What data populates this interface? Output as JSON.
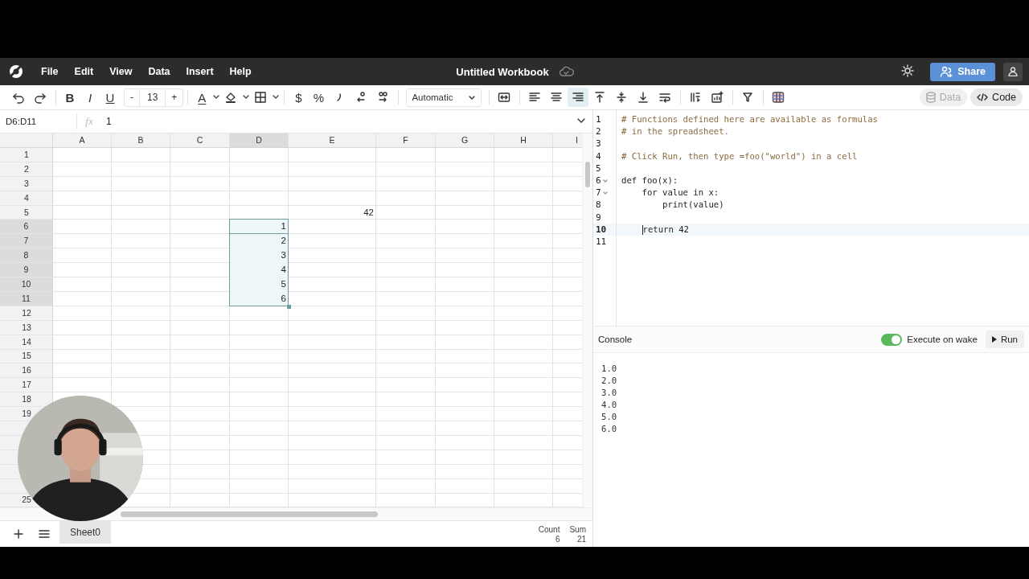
{
  "menubar": {
    "menus": [
      "File",
      "Edit",
      "View",
      "Data",
      "Insert",
      "Help"
    ],
    "title": "Untitled Workbook",
    "share_label": "Share"
  },
  "toolbar": {
    "format_buttons": [
      {
        "label": "B",
        "kind": "bold"
      },
      {
        "label": "I",
        "kind": "italic"
      },
      {
        "label": "U",
        "kind": "underline"
      }
    ],
    "decrease_label": "-",
    "font_size": "13",
    "increase_label": "+",
    "text_color_label": "A",
    "currency_label": "$",
    "percent_label": "%",
    "number_format": "Automatic",
    "align_buttons": [
      {
        "selected": false
      },
      {
        "selected": false
      },
      {
        "selected": true
      }
    ],
    "panel_tabs": [
      {
        "label": "Data",
        "selected": false
      },
      {
        "label": "Code",
        "selected": true
      }
    ]
  },
  "formula_bar": {
    "reference": "D6:D11",
    "fx_label": "fx",
    "value": "1"
  },
  "sheet": {
    "columns": [
      {
        "label": "A",
        "selected": false
      },
      {
        "label": "B",
        "selected": false
      },
      {
        "label": "C",
        "selected": false
      },
      {
        "label": "D",
        "selected": true
      },
      {
        "label": "E",
        "selected": false
      },
      {
        "label": "F",
        "selected": false
      },
      {
        "label": "G",
        "selected": false
      },
      {
        "label": "H",
        "selected": false
      },
      {
        "label": "I",
        "selected": false
      }
    ],
    "rows": [
      {
        "kind": "numbered",
        "label": "1",
        "selected": false
      },
      {
        "kind": "numbered",
        "label": "2",
        "selected": false
      },
      {
        "kind": "numbered",
        "label": "3",
        "selected": false
      },
      {
        "kind": "numbered",
        "label": "4",
        "selected": false
      },
      {
        "kind": "numbered",
        "label": "5",
        "selected": false,
        "cells": [
          null,
          null,
          null,
          null,
          "42",
          null,
          null,
          null,
          null
        ]
      },
      {
        "kind": "numbered",
        "label": "6",
        "selected": true,
        "cells": [
          null,
          null,
          null,
          "1",
          null,
          null,
          null,
          null,
          null
        ]
      },
      {
        "kind": "numbered",
        "label": "7",
        "selected": true,
        "cells": [
          null,
          null,
          null,
          "2",
          null,
          null,
          null,
          null,
          null
        ]
      },
      {
        "kind": "numbered",
        "label": "8",
        "selected": true,
        "cells": [
          null,
          null,
          null,
          "3",
          null,
          null,
          null,
          null,
          null
        ]
      },
      {
        "kind": "numbered",
        "label": "9",
        "selected": true,
        "cells": [
          null,
          null,
          null,
          "4",
          null,
          null,
          null,
          null,
          null
        ]
      },
      {
        "kind": "numbered",
        "label": "10",
        "selected": true,
        "cells": [
          null,
          null,
          null,
          "5",
          null,
          null,
          null,
          null,
          null
        ]
      },
      {
        "kind": "numbered",
        "label": "11",
        "selected": true,
        "cells": [
          null,
          null,
          null,
          "6",
          null,
          null,
          null,
          null,
          null
        ]
      },
      {
        "kind": "numbered",
        "label": "12",
        "selected": false
      },
      {
        "kind": "numbered",
        "label": "13",
        "selected": false
      },
      {
        "kind": "numbered",
        "label": "14",
        "selected": false
      },
      {
        "kind": "numbered",
        "label": "15",
        "selected": false
      },
      {
        "kind": "numbered",
        "label": "16",
        "selected": false
      },
      {
        "kind": "numbered",
        "label": "17",
        "selected": false
      },
      {
        "kind": "numbered",
        "label": "18",
        "selected": false
      },
      {
        "kind": "numbered",
        "label": "19",
        "selected": false
      },
      {
        "kind": "covered"
      },
      {
        "kind": "covered"
      },
      {
        "kind": "covered"
      },
      {
        "kind": "covered"
      },
      {
        "kind": "covered"
      },
      {
        "kind": "numbered",
        "label": "25",
        "selected": false
      }
    ]
  },
  "sheet_tabs": [
    {
      "label": "Sheet0",
      "selected": true
    }
  ],
  "summary": [
    {
      "label": "Count",
      "value": "6"
    },
    {
      "label": "Sum",
      "value": "21"
    }
  ],
  "editor": {
    "lines": [
      {
        "number": "1",
        "kind": "comment",
        "text": "# Functions defined here are available as formulas"
      },
      {
        "number": "2",
        "kind": "comment",
        "text": "# in the spreadsheet."
      },
      {
        "number": "3"
      },
      {
        "number": "4",
        "kind": "comment",
        "text": "# Click Run, then type =foo(\"world\") in a cell"
      },
      {
        "number": "5"
      },
      {
        "number": "6",
        "kind": "code",
        "text": "def foo(x):",
        "foldable": true
      },
      {
        "number": "7",
        "kind": "code",
        "text": "    for value in x:",
        "foldable": true
      },
      {
        "number": "8",
        "kind": "code",
        "text": "        print(value)"
      },
      {
        "number": "9"
      },
      {
        "number": "10",
        "kind": "code",
        "text": "    return 42",
        "active": true
      },
      {
        "number": "11"
      }
    ]
  },
  "console": {
    "title": "Console",
    "execute_on_wake": {
      "label": "Execute on wake",
      "on": true
    },
    "run_label": "Run",
    "output": [
      "1.0",
      "2.0",
      "3.0",
      "4.0",
      "5.0",
      "6.0"
    ]
  }
}
